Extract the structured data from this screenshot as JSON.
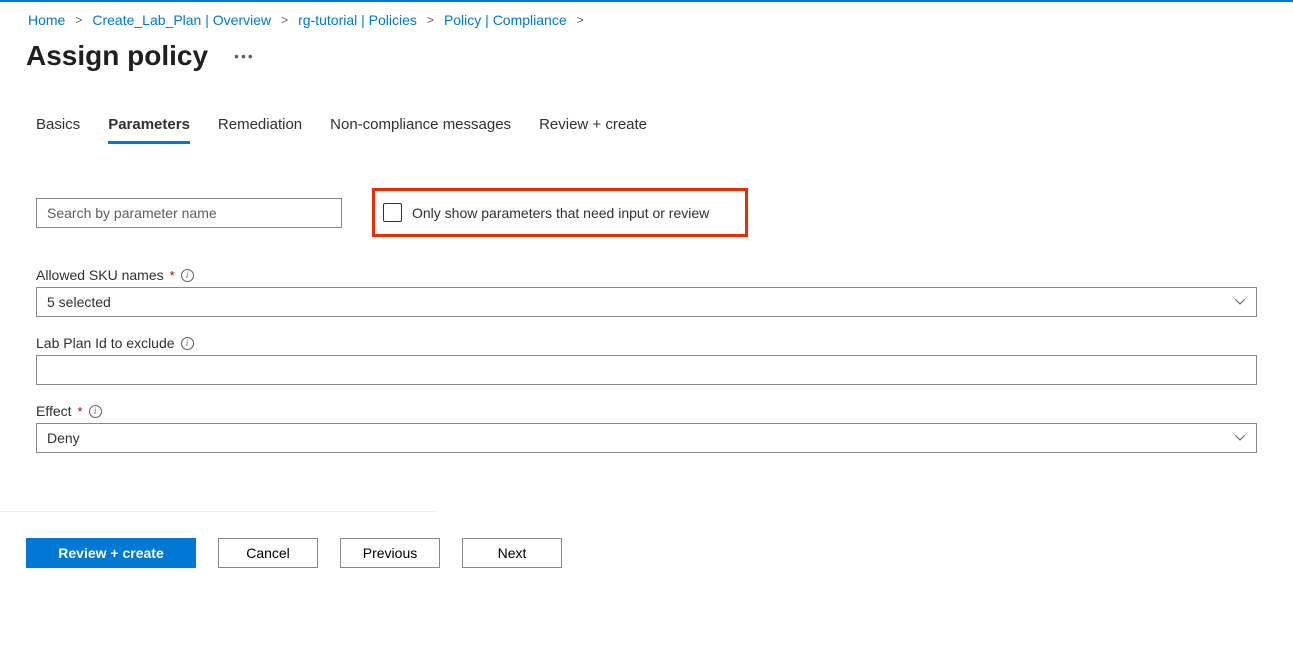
{
  "breadcrumb": [
    {
      "label": "Home"
    },
    {
      "label": "Create_Lab_Plan | Overview"
    },
    {
      "label": "rg-tutorial | Policies"
    },
    {
      "label": "Policy | Compliance"
    }
  ],
  "page_title": "Assign policy",
  "tabs": [
    {
      "label": "Basics",
      "active": false
    },
    {
      "label": "Parameters",
      "active": true
    },
    {
      "label": "Remediation",
      "active": false
    },
    {
      "label": "Non-compliance messages",
      "active": false
    },
    {
      "label": "Review + create",
      "active": false
    }
  ],
  "search": {
    "placeholder": "Search by parameter name"
  },
  "filter_checkbox": {
    "label": "Only show parameters that need input or review",
    "checked": false
  },
  "fields": {
    "allowed_sku": {
      "label": "Allowed SKU names",
      "required": true,
      "value": "5 selected"
    },
    "lab_plan_exclude": {
      "label": "Lab Plan Id to exclude",
      "required": false,
      "value": ""
    },
    "effect": {
      "label": "Effect",
      "required": true,
      "value": "Deny"
    }
  },
  "footer": {
    "review_create": "Review + create",
    "cancel": "Cancel",
    "previous": "Previous",
    "next": "Next"
  }
}
